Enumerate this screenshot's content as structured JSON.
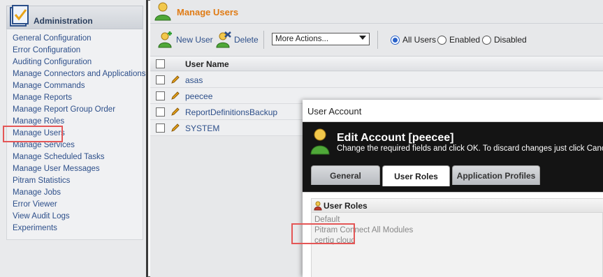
{
  "sidebar": {
    "title": "Administration",
    "items": [
      "General Configuration",
      "Error Configuration",
      "Auditing Configuration",
      "Manage Connectors and Applications",
      "Manage Commands",
      "Manage Reports",
      "Manage Report Group Order",
      "Manage Roles",
      "Manage Users",
      "Manage Services",
      "Manage Scheduled Tasks",
      "Manage User Messages",
      "Pitram Statistics",
      "Manage Jobs",
      "Error Viewer",
      "View Audit Logs",
      "Experiments"
    ]
  },
  "main": {
    "title": "Manage Users",
    "toolbar": {
      "new_user": "New User",
      "delete": "Delete",
      "more_actions": "More Actions...",
      "filter_all": "All Users",
      "filter_enabled": "Enabled",
      "filter_disabled": "Disabled",
      "selected_filter": "All Users"
    },
    "grid": {
      "column": "User Name",
      "rows": [
        "asas",
        "peecee",
        "ReportDefinitionsBackup",
        "SYSTEM"
      ]
    }
  },
  "dialog": {
    "title": "User Account",
    "heading": "Edit Account [peecee]",
    "subtitle": "Change the required fields and click OK. To discard changes just click Cancel.",
    "tabs": [
      "General",
      "User Roles",
      "Application Profiles"
    ],
    "active_tab": "User Roles",
    "roles_header": "User Roles",
    "roles": [
      "Default",
      "Pitram Connect All Modules",
      "certiq cloud"
    ]
  },
  "colors": {
    "accent_orange": "#e07b14",
    "link_blue": "#2d4f8a",
    "highlight_red": "#e45656"
  }
}
